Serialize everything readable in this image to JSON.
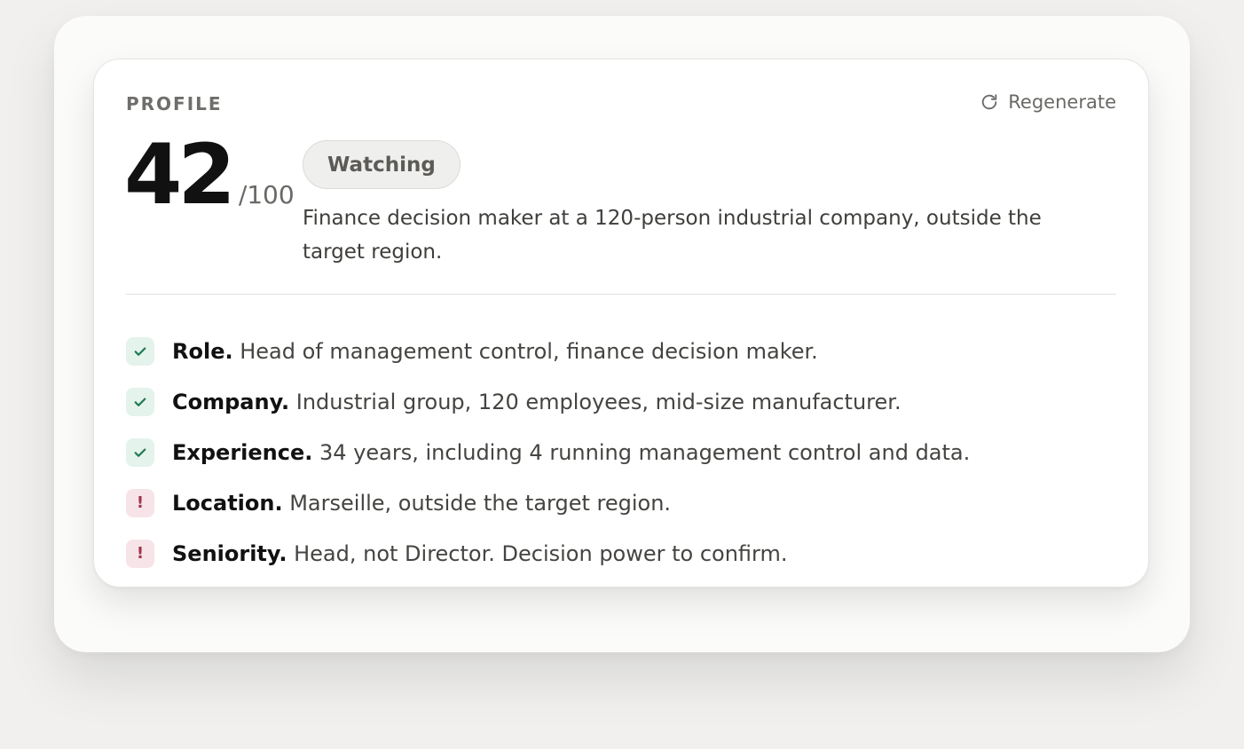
{
  "profile": {
    "section_label": "PROFILE",
    "regenerate_label": "Regenerate",
    "score": "42",
    "score_max": "/100",
    "status_badge": "Watching",
    "summary": "Finance decision maker at a 120-person industrial company, outside the target region."
  },
  "colors": {
    "ok_icon": "#1f7a52",
    "ok_bg": "#e4f3ec",
    "warn_icon": "#a1344f",
    "warn_bg": "#f7e4e8"
  },
  "criteria": [
    {
      "status": "ok",
      "icon": "check-icon",
      "label": "Role.",
      "text": " Head of management control, finance decision maker."
    },
    {
      "status": "ok",
      "icon": "check-icon",
      "label": "Company.",
      "text": " Industrial group, 120 employees, mid-size manufacturer."
    },
    {
      "status": "ok",
      "icon": "check-icon",
      "label": "Experience.",
      "text": " 34 years, including 4 running management control and data."
    },
    {
      "status": "warn",
      "icon": "exclamation-icon",
      "label": "Location.",
      "text": " Marseille, outside the target region."
    },
    {
      "status": "warn",
      "icon": "exclamation-icon",
      "label": "Seniority.",
      "text": " Head, not Director. Decision power to confirm."
    }
  ]
}
